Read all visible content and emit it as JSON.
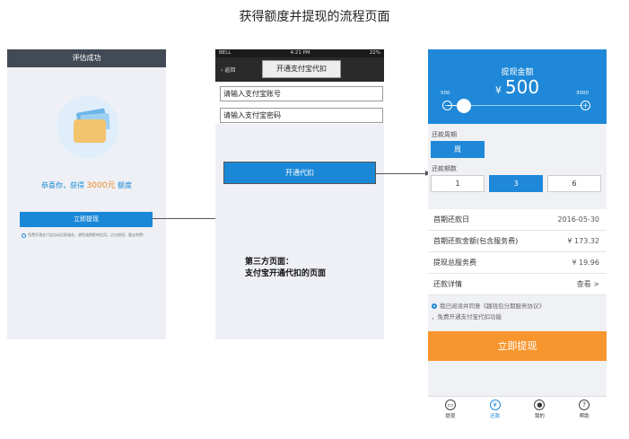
{
  "title": "获得额度并提现的流程页面",
  "screen1": {
    "header": "评估成功",
    "congrats_prefix": "恭喜你，获得",
    "congrats_amount": "3000元",
    "congrats_suffix": "额度",
    "button": "立即提现",
    "note": "免费开通支付宝自动还款服务，避免逾期影响信用，点击按钮，重去则费！"
  },
  "screen2": {
    "status": {
      "carrier": "BELL",
      "time": "4:21 PM",
      "battery": "22%"
    },
    "back": "返回",
    "nav_title": "开通支付宝代扣",
    "account_placeholder": "请输入支付宝账号",
    "password_placeholder": "请输入支付宝密码",
    "button": "开通代扣",
    "third_party_line1": "第三方页面：",
    "third_party_line2": "支付宝开通代扣的页面"
  },
  "screen3": {
    "amount_label": "提现金额",
    "currency": "¥",
    "amount": "500",
    "slider_min": "500",
    "slider_max": "3000",
    "slider_fraction": 0,
    "cycle_label": "还款周期",
    "cycle_value": "周",
    "periods_label": "还款期数",
    "periods": [
      {
        "label": "1",
        "selected": false
      },
      {
        "label": "3",
        "selected": true
      },
      {
        "label": "6",
        "selected": false
      }
    ],
    "rows": [
      {
        "label": "首期还款日",
        "value": "2016-05-30"
      },
      {
        "label": "首期还款金额(包含服务费)",
        "value": "¥ 173.32"
      },
      {
        "label": "提现总服务费",
        "value": "¥ 19.96"
      },
      {
        "label": "还款详情",
        "value": "查看  >"
      }
    ],
    "agree_line1": "我已阅读并同意《趣钱包分期服务协议》",
    "agree_line2": "，免费开通支付宝代扣功能",
    "cash_button": "立即提现",
    "tabs": [
      {
        "label": "提现",
        "icon": "cash-icon",
        "active": false
      },
      {
        "label": "还款",
        "icon": "yen-icon",
        "active": true
      },
      {
        "label": "我的",
        "icon": "user-icon",
        "active": false
      },
      {
        "label": "帮助",
        "icon": "help-icon",
        "active": false
      }
    ]
  },
  "colors": {
    "primary": "#1f88d8",
    "accent": "#f7962e",
    "orange_text": "#f08a24"
  }
}
